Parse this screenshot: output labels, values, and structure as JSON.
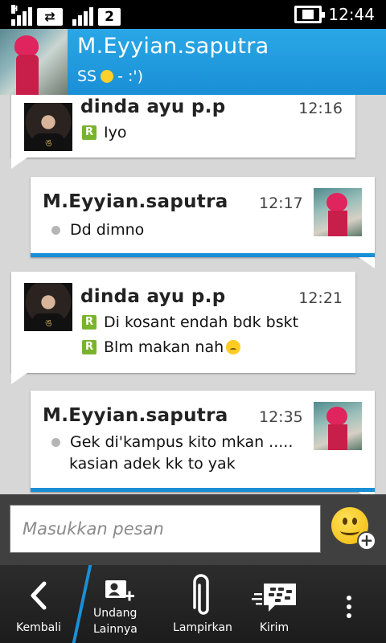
{
  "status_bar": {
    "network_letter": "H",
    "sim_number": "2",
    "time": "12:44",
    "icons": [
      "signal-icon",
      "data-transfer-icon",
      "signal-icon",
      "battery-charging-icon"
    ]
  },
  "header": {
    "contact_name": "M.Eyyian.saputra",
    "status_prefix": "SS",
    "status_suffix": " - :')",
    "avatar_icon": "contact-avatar"
  },
  "messages": [
    {
      "sender": "dinda ayu p.p",
      "time": "12:16",
      "lines": [
        "Iyo"
      ],
      "direction": "in",
      "badge": "R"
    },
    {
      "sender": "M.Eyyian.saputra",
      "time": "12:17",
      "lines": [
        "Dd dimno"
      ],
      "direction": "out"
    },
    {
      "sender": "dinda ayu p.p",
      "time": "12:21",
      "lines": [
        "Di kosant endah bdk bskt",
        "Blm makan nah"
      ],
      "direction": "in",
      "badge": "R"
    },
    {
      "sender": "M.Eyyian.saputra",
      "time": "12:35",
      "lines": [
        "Gek di'kampus kito mkan .....",
        "kasian adek kk to yak"
      ],
      "direction": "out"
    }
  ],
  "composer": {
    "placeholder": "Masukkan pesan",
    "emoji_icon": "emoji-add-icon"
  },
  "actions": [
    {
      "label": "Kembali",
      "icon": "back-icon"
    },
    {
      "label_line1": "Undang",
      "label_line2": "Lainnya",
      "icon": "invite-contact-icon"
    },
    {
      "label": "Lampirkan",
      "icon": "attach-icon"
    },
    {
      "label": "Kirim",
      "icon": "bbm-send-icon"
    },
    {
      "icon": "overflow-menu-icon"
    }
  ],
  "colors": {
    "accent": "#1a8fd6",
    "header": "#2aa7e6",
    "read_badge": "#7ab32c",
    "chat_background": "#d7d7d7"
  }
}
